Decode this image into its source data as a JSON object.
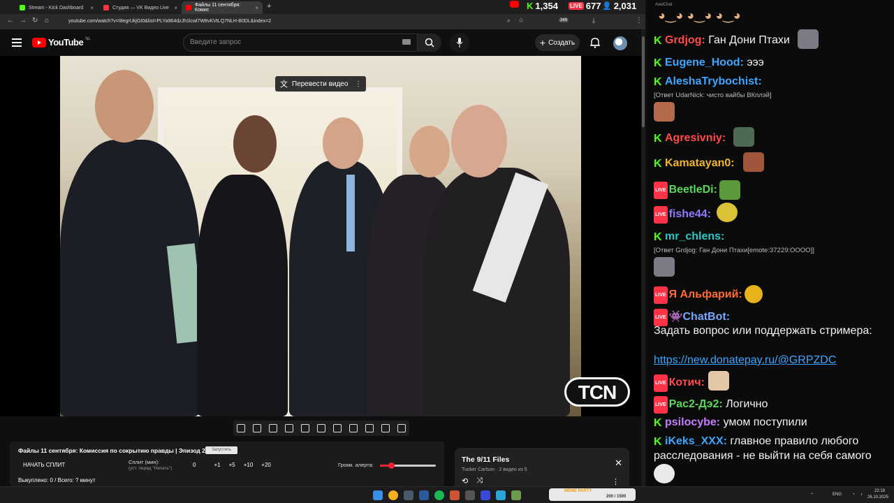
{
  "browser": {
    "tabs": [
      {
        "label": "Stream - Kick Dashboard",
        "icon": "kick-icon",
        "color": "#53fc18"
      },
      {
        "label": "Студия — VK Видео Live",
        "icon": "vk-video-icon",
        "color": "#ff3347"
      },
      {
        "label": "Файлы 11 сентября: Комис",
        "icon": "youtube-icon",
        "color": "#ff0000"
      }
    ],
    "url": "youtube.com/watch?v=I8egrUkjGI0&list=PLYa964dzJh1lcwl7W8vKVtLQ7NLH-B0DL&index=2",
    "ext_badge": "249",
    "counters": {
      "kick": "1,354",
      "vk_badge": "LIVE",
      "vk": "677",
      "viewers": "2,031"
    }
  },
  "youtube": {
    "logo": "YouTube",
    "region": "NL",
    "search_placeholder": "Введите запрос",
    "create_label": "Создать",
    "translate_label": "Перевести видео",
    "watermark": "TCN"
  },
  "extension": {
    "title": "Файлы 11 сентября: Комиссия по сокрытию правды | Эпизод 2",
    "tag": "Запустить",
    "start_label": "НАЧАТЬ СПЛИТ",
    "split_label": "Сплит (мин):",
    "split_hint": "(уст. перед \"Начать\")",
    "split_value": "0",
    "steps": [
      "+1",
      "+5",
      "+10",
      "+20"
    ],
    "alert_label": "Громк. алерта:",
    "alert_volume": 0.2,
    "bought_label": "Выкуплено: 0 / Всего: ? минут"
  },
  "playlist": {
    "title": "The 9/11 Files",
    "subtitle": "Tucker Carlson · 2 видео из 5"
  },
  "chat": {
    "header": "AxelChat",
    "messages": [
      {
        "platform": "kick",
        "nick": "Grdjog:",
        "color": "#ff4b4b",
        "text": "Ган Дони Птахи"
      },
      {
        "platform": "kick",
        "nick": "Eugene_Hood:",
        "color": "#3ea6ff",
        "text": "эээ"
      },
      {
        "platform": "kick",
        "nick": "AleshaTrybochist:",
        "color": "#3ea6ff",
        "text": "",
        "reply": "[Ответ UdarNick: чисто вайбы ВКплэй]"
      },
      {
        "platform": "kick",
        "nick": "Agresivniy:",
        "color": "#ff4b4b",
        "text": ""
      },
      {
        "platform": "kick",
        "nick": "Kamatayan0:",
        "color": "#f0b429",
        "text": ""
      },
      {
        "platform": "vk",
        "nick": "BeetleDi:",
        "color": "#5bd75b",
        "text": ""
      },
      {
        "platform": "vk",
        "nick": "fishe44:",
        "color": "#8e7bff",
        "text": ""
      },
      {
        "platform": "kick",
        "nick": "mr_chlens:",
        "color": "#2ec7c7",
        "text": "",
        "reply": "[Ответ Grdjog: Ган Дони Птахи[emote:37229:OOOO]]"
      },
      {
        "platform": "vk",
        "nick": "Я Альфарий:",
        "color": "#ff6b35",
        "text": ""
      },
      {
        "platform": "vk",
        "nick": "ChatBot:",
        "color": "#7aa7ff",
        "text": ""
      },
      {
        "platform": "vk",
        "nick": "Котич:",
        "color": "#ff4b4b",
        "text": ""
      },
      {
        "platform": "vk",
        "nick": "Pac2-Дэ2:",
        "color": "#5bd75b",
        "text": "Логично"
      },
      {
        "platform": "kick",
        "nick": "psilocybe:",
        "color": "#c77bff",
        "text": "умом поступили"
      },
      {
        "platform": "kick",
        "nick": "iKeks_XXX:",
        "color": "#3ea6ff",
        "text": "главное правило любого расследования - не выйти на себя самого"
      }
    ],
    "bot_text": "Задать вопрос или поддержать стримера:",
    "bot_link": "https://new.donatepay.ru/@GRPZDC"
  },
  "taskbar": {
    "lang": "ENG",
    "time": "22:19",
    "date": "26.10.2025",
    "meme_label": "MEME PARTY",
    "meme_progress": "200 / 1500"
  }
}
